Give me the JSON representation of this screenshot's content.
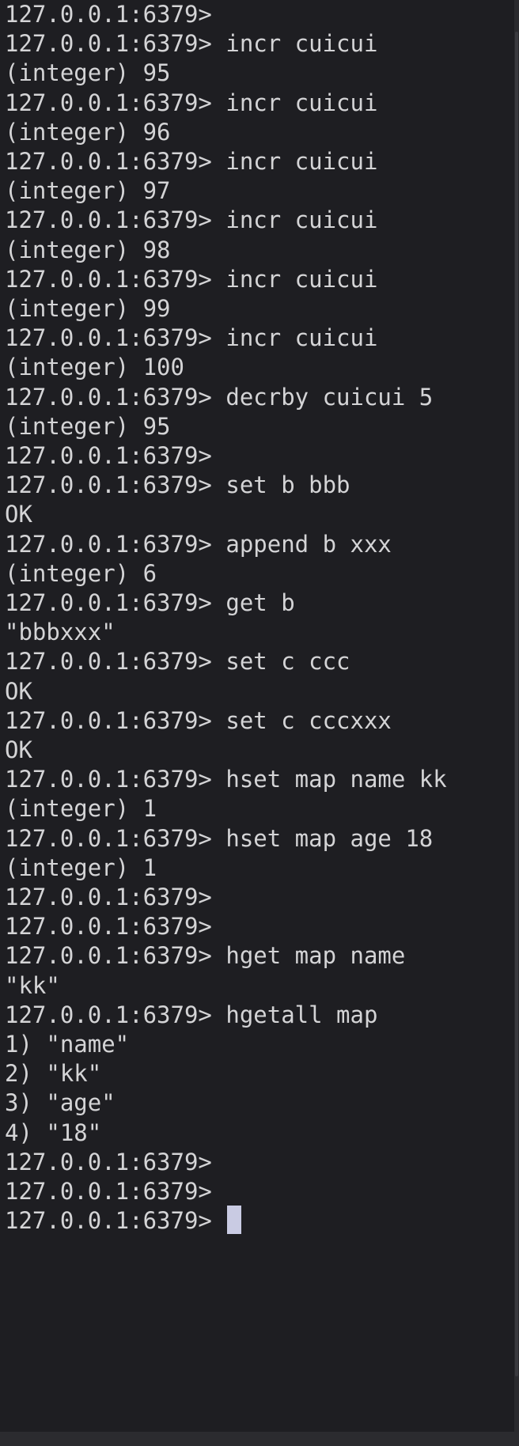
{
  "terminal": {
    "prompt": "127.0.0.1:6379>",
    "lines": [
      {
        "type": "prompt",
        "command": ""
      },
      {
        "type": "prompt",
        "command": "incr cuicui"
      },
      {
        "type": "output",
        "text": "(integer) 95"
      },
      {
        "type": "prompt",
        "command": "incr cuicui"
      },
      {
        "type": "output",
        "text": "(integer) 96"
      },
      {
        "type": "prompt",
        "command": "incr cuicui"
      },
      {
        "type": "output",
        "text": "(integer) 97"
      },
      {
        "type": "prompt",
        "command": "incr cuicui"
      },
      {
        "type": "output",
        "text": "(integer) 98"
      },
      {
        "type": "prompt",
        "command": "incr cuicui"
      },
      {
        "type": "output",
        "text": "(integer) 99"
      },
      {
        "type": "prompt",
        "command": "incr cuicui"
      },
      {
        "type": "output",
        "text": "(integer) 100"
      },
      {
        "type": "prompt",
        "command": "decrby cuicui 5"
      },
      {
        "type": "output",
        "text": "(integer) 95"
      },
      {
        "type": "prompt",
        "command": ""
      },
      {
        "type": "prompt",
        "command": "set b bbb"
      },
      {
        "type": "output",
        "text": "OK"
      },
      {
        "type": "prompt",
        "command": "append b xxx"
      },
      {
        "type": "output",
        "text": "(integer) 6"
      },
      {
        "type": "prompt",
        "command": "get b"
      },
      {
        "type": "output",
        "text": "\"bbbxxx\""
      },
      {
        "type": "prompt",
        "command": "set c ccc"
      },
      {
        "type": "output",
        "text": "OK"
      },
      {
        "type": "prompt",
        "command": "set c cccxxx"
      },
      {
        "type": "output",
        "text": "OK"
      },
      {
        "type": "prompt",
        "command": "hset map name kk"
      },
      {
        "type": "output",
        "text": "(integer) 1"
      },
      {
        "type": "prompt",
        "command": "hset map age 18"
      },
      {
        "type": "output",
        "text": "(integer) 1"
      },
      {
        "type": "prompt",
        "command": ""
      },
      {
        "type": "prompt",
        "command": ""
      },
      {
        "type": "prompt",
        "command": "hget map name"
      },
      {
        "type": "output",
        "text": "\"kk\""
      },
      {
        "type": "prompt",
        "command": "hgetall map"
      },
      {
        "type": "output",
        "text": "1) \"name\""
      },
      {
        "type": "output",
        "text": "2) \"kk\""
      },
      {
        "type": "output",
        "text": "3) \"age\""
      },
      {
        "type": "output",
        "text": "4) \"18\""
      },
      {
        "type": "prompt",
        "command": ""
      },
      {
        "type": "prompt",
        "command": ""
      },
      {
        "type": "prompt",
        "command": "",
        "cursor": true
      }
    ]
  },
  "colors": {
    "background": "#1e1e22",
    "text": "#d4d4d6",
    "cursor": "#c9cbe3"
  }
}
